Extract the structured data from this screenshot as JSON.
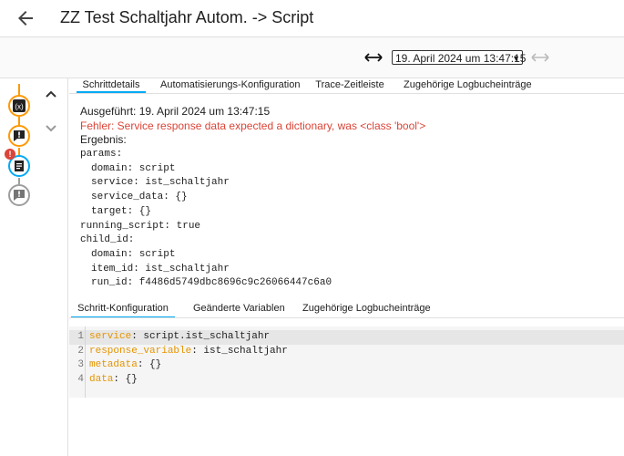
{
  "header": {
    "title": "ZZ Test Schaltjahr Autom. -> Script"
  },
  "toolbar": {
    "selected_run": "19. April 2024 um 13:47:15"
  },
  "tabs_top": [
    "Schrittdetails",
    "Automatisierungs-Konfiguration",
    "Trace-Zeitleiste",
    "Zugehörige Logbucheinträge"
  ],
  "details": {
    "executed": "Ausgeführt: 19. April 2024 um 13:47:15",
    "error": "Fehler: Service response data expected a dictionary, was <class 'bool'>",
    "result_label": "Ergebnis:",
    "lines": [
      "params:",
      "domain: script",
      "service: ist_schaltjahr",
      "service_data: {}",
      "target: {}",
      "running_script: true",
      "child_id:",
      "domain: script",
      "item_id: ist_schaltjahr",
      "run_id: f4486d5749dbc8696c9c26066447c6a0"
    ]
  },
  "tabs_bottom": [
    "Schritt-Konfiguration",
    "Geänderte Variablen",
    "Zugehörige Logbucheinträge"
  ],
  "code": [
    {
      "n": "1",
      "key": "service",
      "value": " script.ist_schaltjahr"
    },
    {
      "n": "2",
      "key": "response_variable",
      "value": " ist_schaltjahr"
    },
    {
      "n": "3",
      "key": "metadata",
      "value": " {}"
    },
    {
      "n": "4",
      "key": "data",
      "value": " {}"
    }
  ],
  "trace_nodes": [
    "variable-icon",
    "alert-icon",
    "script-icon",
    "alert-icon"
  ],
  "error_badge": "!",
  "colors": {
    "accent": "#03a9f4",
    "orange": "#ff9800",
    "error": "#db4437",
    "grey": "#616161"
  }
}
